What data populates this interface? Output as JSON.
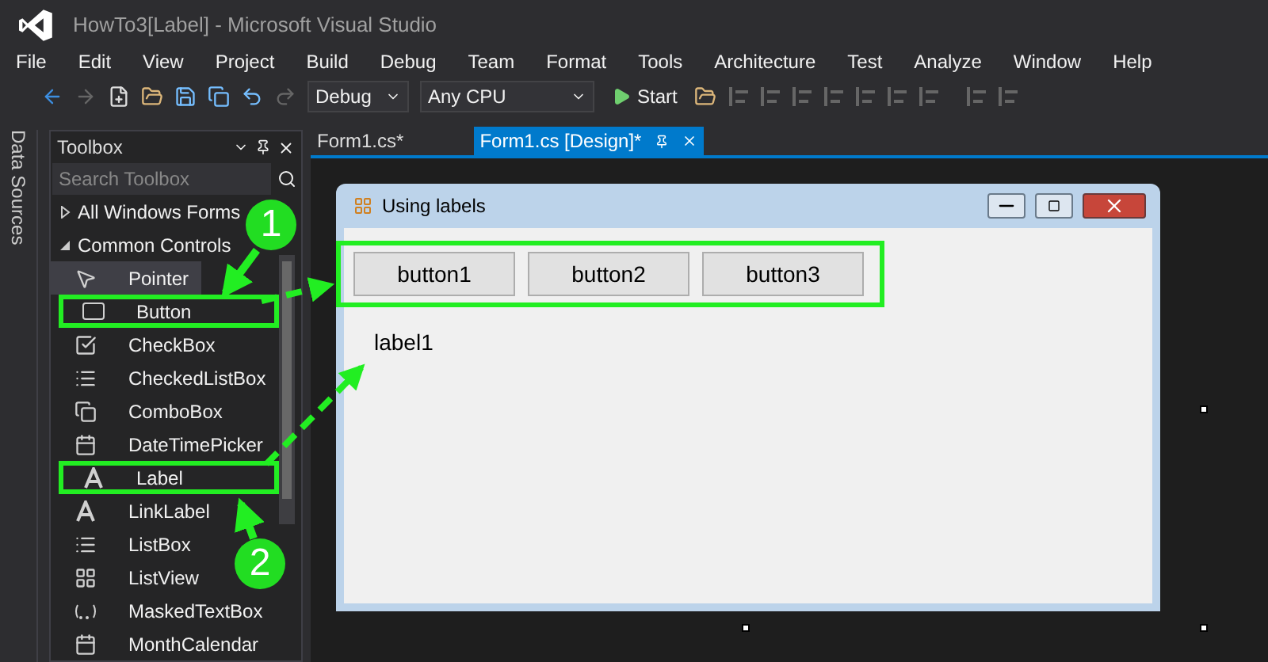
{
  "window": {
    "title": "HowTo3[Label] - Microsoft Visual Studio"
  },
  "menu": [
    "File",
    "Edit",
    "View",
    "Project",
    "Build",
    "Debug",
    "Team",
    "Format",
    "Tools",
    "Architecture",
    "Test",
    "Analyze",
    "Window",
    "Help"
  ],
  "toolbar": {
    "configuration": "Debug",
    "platform": "Any CPU",
    "start": "Start"
  },
  "side_tab": "Data Sources",
  "toolbox": {
    "title": "Toolbox",
    "search": {
      "placeholder": "Search Toolbox"
    },
    "groups": [
      {
        "label": "All Windows Forms",
        "expanded": false
      },
      {
        "label": "Common Controls",
        "expanded": true,
        "items": [
          {
            "label": "Pointer",
            "kind": "pointer",
            "selected": true,
            "highlighted": false
          },
          {
            "label": "Button",
            "kind": "button",
            "selected": false,
            "highlighted": true
          },
          {
            "label": "CheckBox",
            "kind": "checkbox",
            "selected": false,
            "highlighted": false
          },
          {
            "label": "CheckedListBox",
            "kind": "list",
            "selected": false,
            "highlighted": false
          },
          {
            "label": "ComboBox",
            "kind": "combo",
            "selected": false,
            "highlighted": false
          },
          {
            "label": "DateTimePicker",
            "kind": "calendar",
            "selected": false,
            "highlighted": false
          },
          {
            "label": "Label",
            "kind": "letter",
            "selected": false,
            "highlighted": true
          },
          {
            "label": "LinkLabel",
            "kind": "letter",
            "selected": false,
            "highlighted": false
          },
          {
            "label": "ListBox",
            "kind": "listbox",
            "selected": false,
            "highlighted": false
          },
          {
            "label": "ListView",
            "kind": "grid",
            "selected": false,
            "highlighted": false
          },
          {
            "label": "MaskedTextBox",
            "kind": "masked",
            "selected": false,
            "highlighted": false
          },
          {
            "label": "MonthCalendar",
            "kind": "calendar",
            "selected": false,
            "highlighted": false
          }
        ]
      }
    ]
  },
  "tabs": [
    {
      "label": "Form1.cs*",
      "selected": false
    },
    {
      "label": "Form1.cs [Design]*",
      "selected": true
    }
  ],
  "form": {
    "title": "Using labels",
    "buttons": [
      "button1",
      "button2",
      "button3"
    ],
    "label": "label1"
  },
  "annotations": [
    {
      "number": "1"
    },
    {
      "number": "2"
    }
  ]
}
